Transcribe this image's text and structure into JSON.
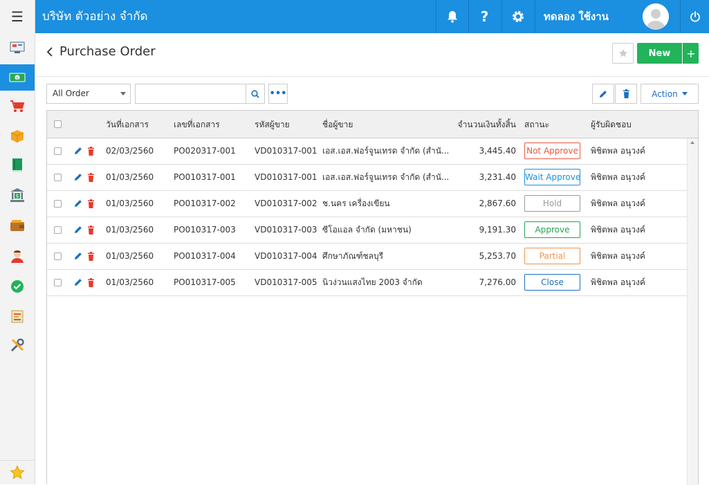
{
  "header": {
    "menu_icon": "hamburger-icon",
    "company": "บริษัท ตัวอย่าง จำกัด",
    "username": "ทดลอง ใช้งาน",
    "help_label": "?"
  },
  "sidebar": {
    "items": [
      {
        "icon": "dashboard-icon"
      },
      {
        "icon": "money-icon"
      },
      {
        "icon": "cart-icon"
      },
      {
        "icon": "box-icon"
      },
      {
        "icon": "book-icon"
      },
      {
        "icon": "bank-icon"
      },
      {
        "icon": "wallet-icon"
      },
      {
        "icon": "people-icon"
      },
      {
        "icon": "check-icon"
      },
      {
        "icon": "report-icon"
      },
      {
        "icon": "tools-icon"
      }
    ],
    "favorite_icon": "star-icon"
  },
  "page": {
    "title": "Purchase Order",
    "new_label": "New",
    "plus_label": "+",
    "filter_value": "All Order",
    "search_value": "",
    "more_label": "•••",
    "action_label": "Action"
  },
  "table": {
    "columns": [
      "วันที่เอกสาร",
      "เลขที่เอกสาร",
      "รหัสผู้ขาย",
      "ชื่อผู้ขาย",
      "จำนวนเงินทั้งสิ้น",
      "สถานะ",
      "ผู้รับผิดชอบ"
    ],
    "rows": [
      {
        "date": "02/03/2560",
        "doc_no": "PO020317-001",
        "vendor_code": "VD010317-001",
        "vendor_name": "เอส.เอส.ฟอร์จูนเทรด จำกัด (สำนั...",
        "amount": "3,445.40",
        "status": "Not Approve",
        "owner": "พิชิตพล อนุวงค์"
      },
      {
        "date": "01/03/2560",
        "doc_no": "PO010317-001",
        "vendor_code": "VD010317-001",
        "vendor_name": "เอส.เอส.ฟอร์จูนเทรด จำกัด (สำนั...",
        "amount": "3,231.40",
        "status": "Wait Approve",
        "owner": "พิชิตพล อนุวงค์"
      },
      {
        "date": "01/03/2560",
        "doc_no": "PO010317-002",
        "vendor_code": "VD010317-002",
        "vendor_name": "ช.นคร เครื่องเขียน",
        "amount": "2,867.60",
        "status": "Hold",
        "owner": "พิชิตพล อนุวงค์"
      },
      {
        "date": "01/03/2560",
        "doc_no": "PO010317-003",
        "vendor_code": "VD010317-003",
        "vendor_name": "ซีโอแอล จำกัด (มหาชน)",
        "amount": "9,191.30",
        "status": "Approve",
        "owner": "พิชิตพล อนุวงค์"
      },
      {
        "date": "01/03/2560",
        "doc_no": "PO010317-004",
        "vendor_code": "VD010317-004",
        "vendor_name": "ศึกษาภัณฑ์ชลบุรี",
        "amount": "5,253.70",
        "status": "Partial",
        "owner": "พิชิตพล อนุวงค์"
      },
      {
        "date": "01/03/2560",
        "doc_no": "PO010317-005",
        "vendor_code": "VD010317-005",
        "vendor_name": "นิวง่วนแสงไทย 2003 จำกัด",
        "amount": "7,276.00",
        "status": "Close",
        "owner": "พิชิตพล อนุวงค์"
      }
    ]
  },
  "colors": {
    "brand": "#1b8fe0",
    "new_button": "#22b45a",
    "status_not_approve": "#e8573f",
    "status_wait_approve": "#1b8fe0",
    "status_hold": "#999999",
    "status_approve": "#22a350",
    "status_partial": "#f0944d",
    "status_close": "#1b6fc0",
    "edit_icon": "#1b6fc0",
    "delete_icon": "#e8392c"
  }
}
